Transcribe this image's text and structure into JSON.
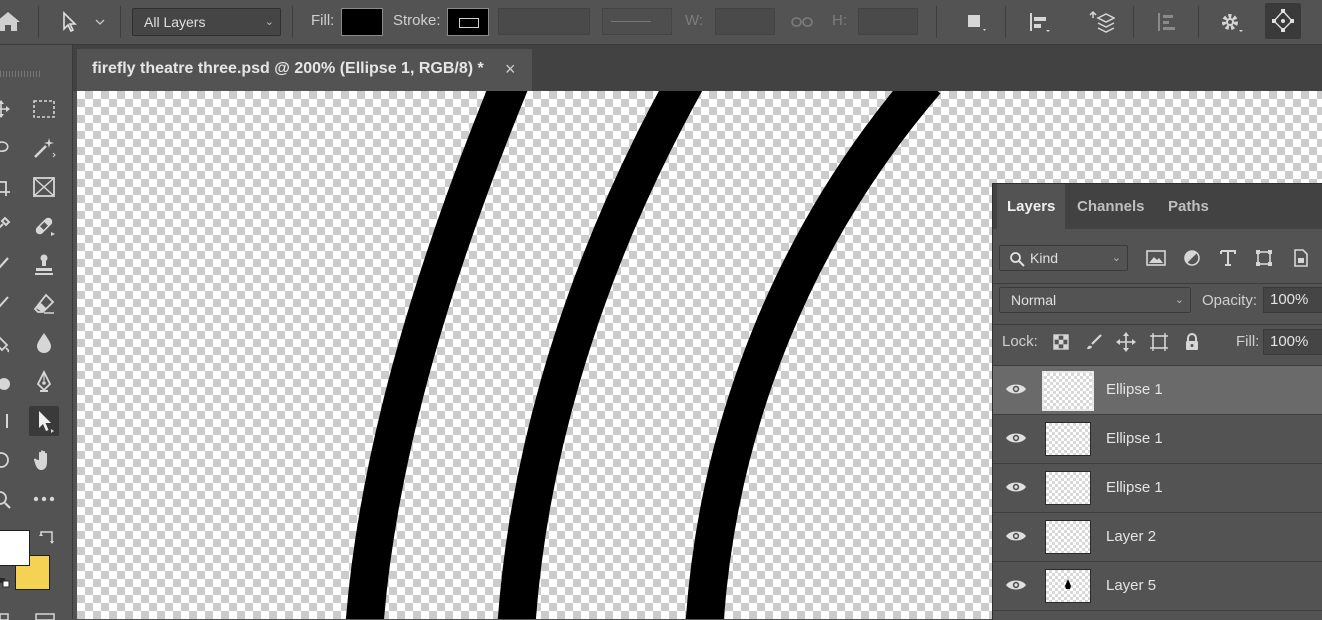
{
  "options_bar": {
    "layer_select": "All Layers",
    "fill_label": "Fill:",
    "fill_color": "#000000",
    "stroke_label": "Stroke:",
    "w_label": "W:",
    "h_label": "H:"
  },
  "document": {
    "tab_title": "firefly theatre three.psd @ 200% (Ellipse 1, RGB/8) *",
    "close_symbol": "×"
  },
  "toolbar": {
    "foreground_color": "#ffffff",
    "background_color": "#f5d254",
    "selected_tool": "path-selection-tool"
  },
  "layers_panel": {
    "tabs": [
      {
        "label": "Layers",
        "active": true
      },
      {
        "label": "Channels",
        "active": false
      },
      {
        "label": "Paths",
        "active": false
      }
    ],
    "filter_kind": "Kind",
    "blend_mode": "Normal",
    "opacity_label": "Opacity:",
    "opacity_value": "100%",
    "lock_label": "Lock:",
    "fill_label": "Fill:",
    "fill_value": "100%",
    "layers": [
      {
        "name": "Ellipse 1",
        "selected": true,
        "visible": true
      },
      {
        "name": "Ellipse 1",
        "selected": false,
        "visible": true
      },
      {
        "name": "Ellipse 1",
        "selected": false,
        "visible": true
      },
      {
        "name": "Layer 2",
        "selected": false,
        "visible": true
      },
      {
        "name": "Layer 5",
        "selected": false,
        "visible": true
      }
    ]
  }
}
